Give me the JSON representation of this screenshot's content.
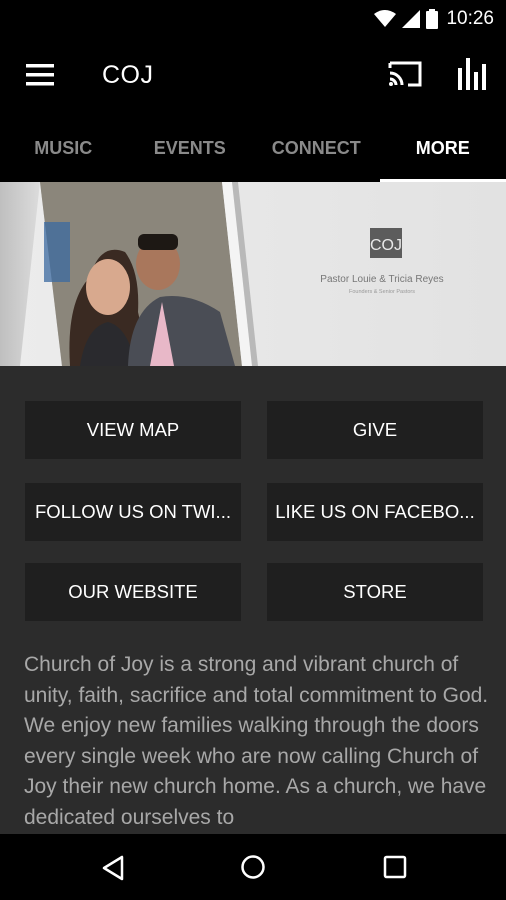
{
  "status_bar": {
    "time": "10:26",
    "icons": [
      "wifi-icon",
      "signal-icon",
      "battery-icon"
    ]
  },
  "app_bar": {
    "title": "COJ",
    "icons": [
      "menu-icon",
      "cast-icon",
      "equalizer-icon"
    ]
  },
  "tabs": [
    {
      "label": "MUSIC",
      "active": false
    },
    {
      "label": "EVENTS",
      "active": false
    },
    {
      "label": "CONNECT",
      "active": false
    },
    {
      "label": "MORE",
      "active": true
    }
  ],
  "banner": {
    "logo_text": "COJ",
    "pastor_names": "Pastor Louie & Tricia Reyes",
    "pastor_role": "Founders & Senior Pastors"
  },
  "buttons": [
    {
      "label": "VIEW MAP"
    },
    {
      "label": "GIVE"
    },
    {
      "label": "FOLLOW US ON TWI..."
    },
    {
      "label": "LIKE US ON FACEBO..."
    },
    {
      "label": "OUR WEBSITE"
    },
    {
      "label": "STORE"
    }
  ],
  "description": "Church of Joy is a strong and vibrant church of unity, faith, sacrifice and total commitment to God.  We enjoy new families walking through the doors every single week who are now calling Church of Joy their new church home. As a church, we have dedicated ourselves to",
  "nav_bar": {
    "icons": [
      "back-icon",
      "home-icon",
      "recents-icon"
    ]
  },
  "colors": {
    "background": "#2c2c2c",
    "button_bg": "#1f1f1f",
    "bar_bg": "#000000",
    "tab_inactive": "#8a8a8a",
    "text_muted": "#a8a8a8"
  }
}
